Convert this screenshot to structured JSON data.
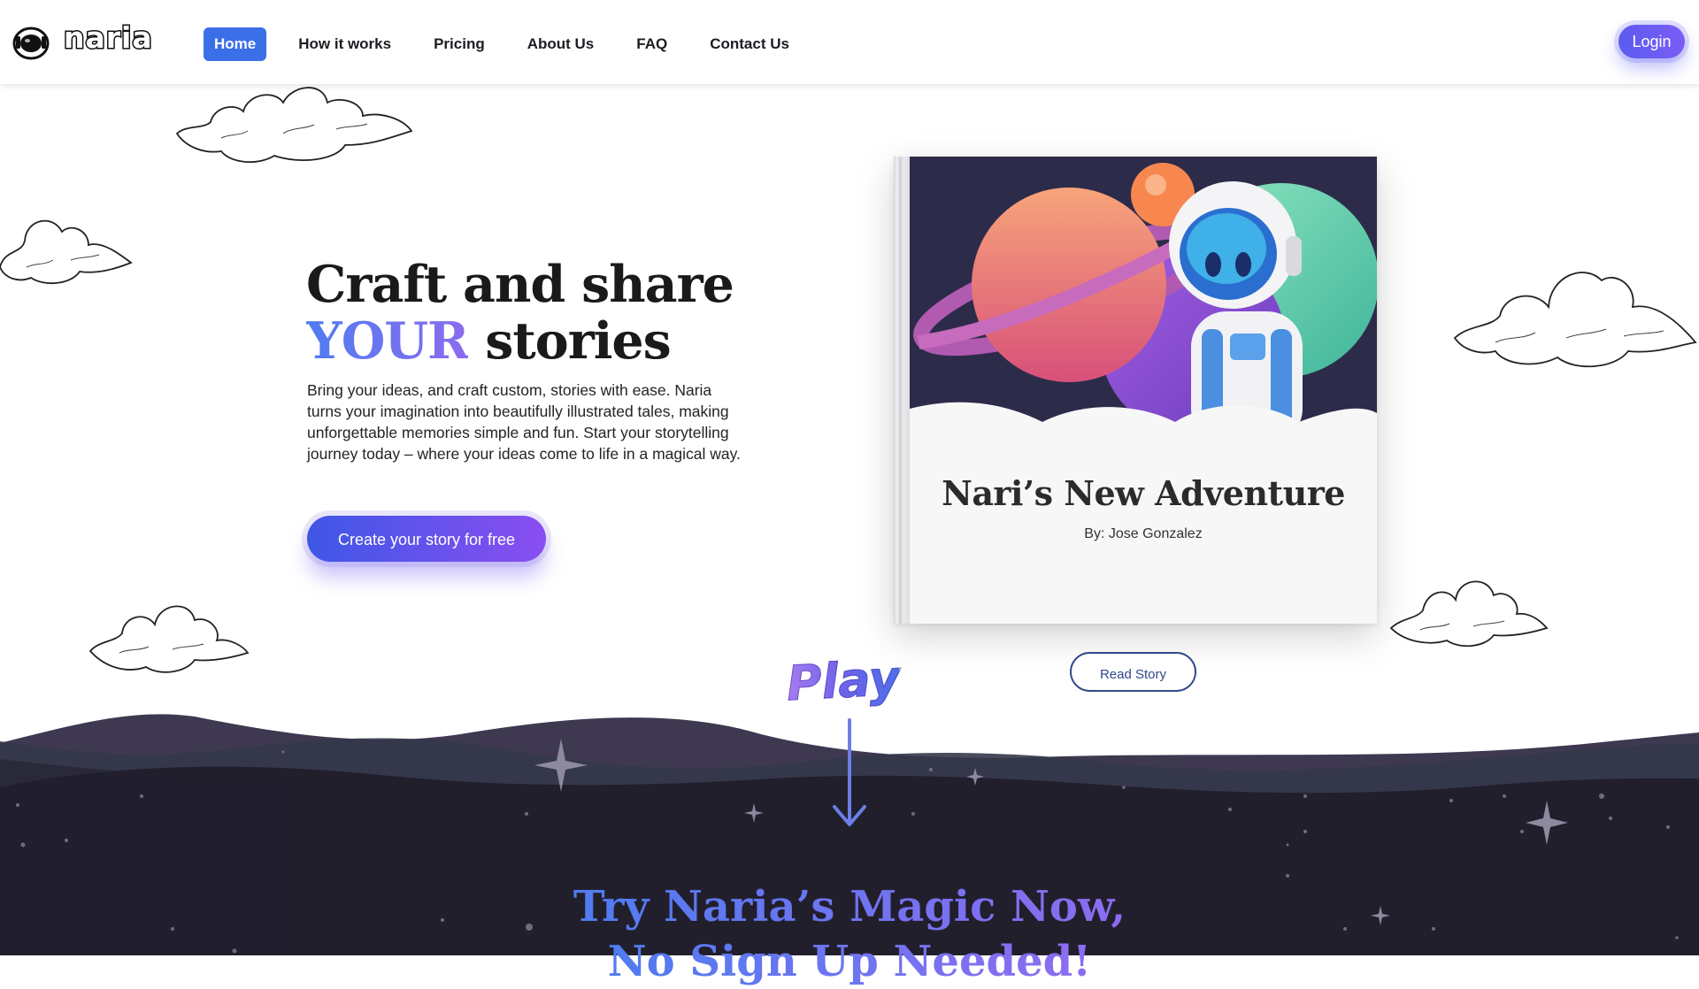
{
  "brand": {
    "name": "naria",
    "logo_icon": "astronaut-helmet-icon"
  },
  "nav": {
    "links": [
      {
        "label": "Home",
        "active": true
      },
      {
        "label": "How it works",
        "active": false
      },
      {
        "label": "Pricing",
        "active": false
      },
      {
        "label": "About Us",
        "active": false
      },
      {
        "label": "FAQ",
        "active": false
      },
      {
        "label": "Contact Us",
        "active": false
      }
    ],
    "login_label": "Login"
  },
  "hero": {
    "title_line1": "Craft and share",
    "title_accent": "YOUR",
    "title_rest": " stories",
    "description": "Bring your ideas, and craft custom, stories with ease. Naria turns your imagination into beautifully illustrated tales, making unforgettable memories simple and fun. Start your storytelling journey today – where your ideas come to life in a magical way.",
    "cta_label": "Create your story for free"
  },
  "book": {
    "title": "Nari’s New Adventure",
    "author": "By: Jose Gonzalez",
    "read_label": "Read Story"
  },
  "play": {
    "label": "Play"
  },
  "section": {
    "heading_line1": "Try Naria’s Magic Now,",
    "heading_line2": "No Sign Up Needed!"
  },
  "colors": {
    "accent_blue": "#3b6fe8",
    "accent_purple": "#8a4ef0",
    "dark_bg": "#211f2c"
  }
}
